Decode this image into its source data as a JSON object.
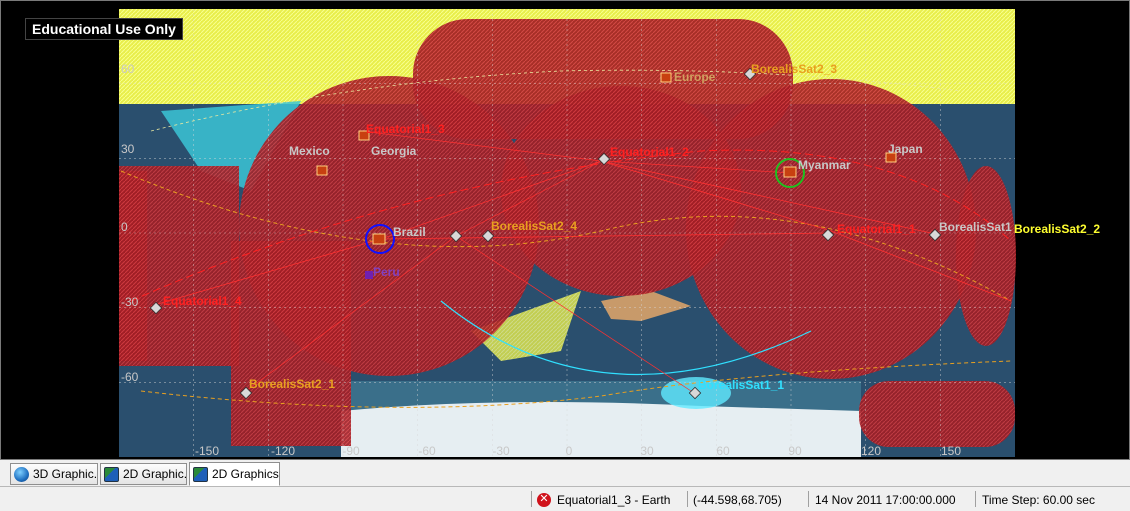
{
  "watermark": "Educational Use Only",
  "map": {
    "lon_ticks": [
      "-150",
      "-120",
      "-90",
      "-60",
      "-30",
      "0",
      "30",
      "60",
      "90",
      "120",
      "150"
    ],
    "lat_ticks": [
      "60",
      "30",
      "0",
      "-30",
      "-60"
    ],
    "facilities": [
      {
        "label": "Mexico"
      },
      {
        "label": "Georgia"
      },
      {
        "label": "Europe"
      },
      {
        "label": "Myanmar"
      },
      {
        "label": "Japan"
      },
      {
        "label": "Brazil"
      },
      {
        "label": "Peru"
      }
    ],
    "satellites": [
      {
        "label": "Equatorial1_2",
        "color": "#ff2020"
      },
      {
        "label": "Equatorial1_1",
        "color": "#ff2020"
      },
      {
        "label": "Equatorial1_3",
        "color": "#ff2020"
      },
      {
        "label": "Equatorial1_4",
        "color": "#ff2020"
      },
      {
        "label": "BorealisSat2_3",
        "color": "#e8a020"
      },
      {
        "label": "BorealisSat2_4",
        "color": "#e8a020"
      },
      {
        "label": "BorealisSat2_1",
        "color": "#e8a020"
      },
      {
        "label": "BorealisSat2_2",
        "color": "#ffff30"
      },
      {
        "label": "BorealisSat1_1",
        "color": "#30e0ff"
      },
      {
        "label": "BorealisSat1",
        "color": "#c8c8c8"
      }
    ]
  },
  "tabs": [
    {
      "label": "3D Graphic...",
      "icon": "globe-icon"
    },
    {
      "label": "2D Graphic...",
      "icon": "map-icon"
    },
    {
      "label": "2D Graphics ...",
      "icon": "map-icon",
      "active": true
    }
  ],
  "status": {
    "object": "Equatorial1_3 - Earth",
    "coords": "(-44.598,68.705)",
    "time": "14 Nov 2011 17:00:00.000",
    "step": "Time Step: 60.00 sec"
  }
}
